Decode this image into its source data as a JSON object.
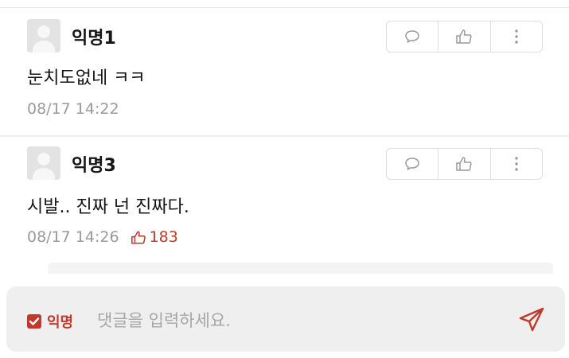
{
  "colors": {
    "accent": "#c0392b",
    "muted_text": "#9a9a9a",
    "input_bg": "#efefef"
  },
  "comments": [
    {
      "author": "익명1",
      "content": "눈치도없네 ㅋㅋ",
      "timestamp": "08/17 14:22",
      "likes": null,
      "icons": {
        "reply": "comment-bubble-icon",
        "like": "thumbs-up-icon",
        "more": "more-vertical-icon"
      }
    },
    {
      "author": "익명3",
      "content": "시발.. 진짜 넌 진짜다.",
      "timestamp": "08/17 14:26",
      "likes": "183",
      "icons": {
        "reply": "comment-bubble-icon",
        "like": "thumbs-up-icon",
        "more": "more-vertical-icon"
      }
    }
  ],
  "input_bar": {
    "anonymous_label": "익명",
    "anonymous_checked": true,
    "placeholder": "댓글을 입력하세요.",
    "value": "",
    "send_icon": "send-icon"
  }
}
